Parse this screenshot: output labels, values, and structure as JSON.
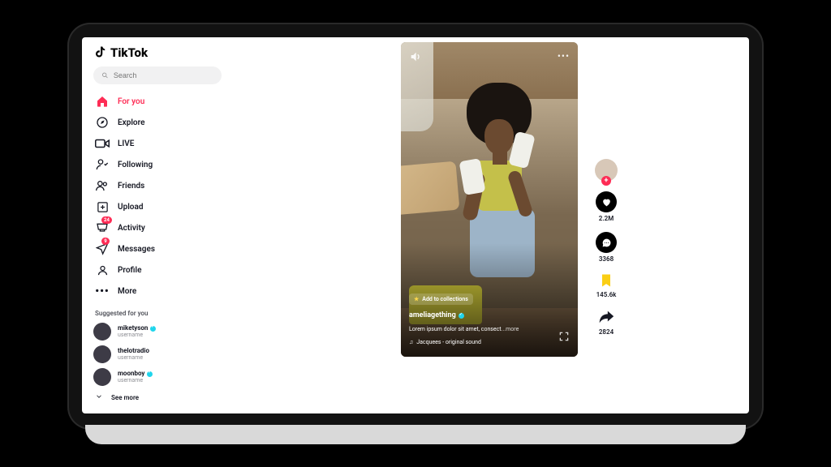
{
  "brand": "TikTok",
  "search": {
    "placeholder": "Search"
  },
  "nav": {
    "for_you": "For you",
    "explore": "Explore",
    "live": "LIVE",
    "following": "Following",
    "friends": "Friends",
    "upload": "Upload",
    "activity": "Activity",
    "messages": "Messages",
    "profile": "Profile",
    "more": "More",
    "activity_badge": "24",
    "messages_badge": "9"
  },
  "suggested": {
    "title": "Suggested for you",
    "items": [
      {
        "user": "miketyson",
        "handle": "username",
        "verified": true
      },
      {
        "user": "thelotradio",
        "handle": "username",
        "verified": false
      },
      {
        "user": "moonboy",
        "handle": "username",
        "verified": true
      }
    ],
    "see_more": "See more"
  },
  "video": {
    "add_collections": "Add to collections",
    "author": "ameliagething",
    "author_verified": true,
    "caption": "Lorem ipsum dolor sit amet, consect",
    "caption_more": "...more",
    "music": "Jacquees - original sound"
  },
  "actions": {
    "likes": "2.2M",
    "comments": "3368",
    "saves": "145.6k",
    "shares": "2824"
  }
}
